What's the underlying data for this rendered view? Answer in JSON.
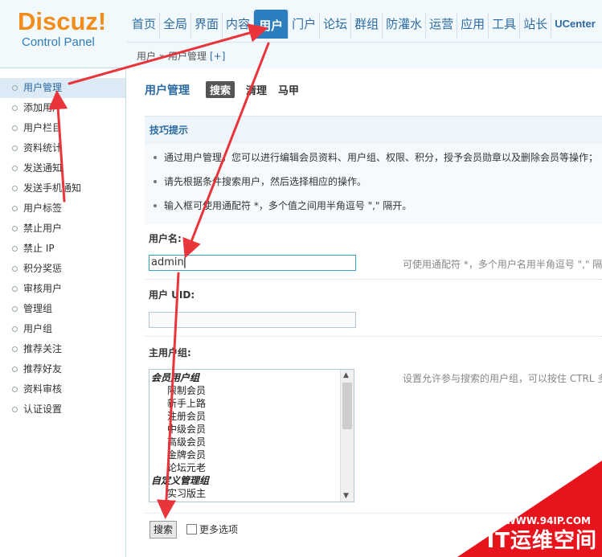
{
  "logo": {
    "brand": "Discuz!",
    "subtitle": "Control Panel"
  },
  "topnav": [
    "首页",
    "全局",
    "界面",
    "内容",
    "用户",
    "门户",
    "论坛",
    "群组",
    "防灌水",
    "运营",
    "应用",
    "工具",
    "站长",
    "UCenter"
  ],
  "topnav_active": "用户",
  "breadcrumb": {
    "path": "用户 » 用户管理",
    "add": "[+]"
  },
  "sidebar": {
    "items": [
      "用户管理",
      "添加用户",
      "用户栏目",
      "资料统计",
      "发送通知",
      "发送手机通知",
      "用户标签",
      "禁止用户",
      "禁止 IP",
      "积分奖惩",
      "审核用户",
      "管理组",
      "用户组",
      "推荐关注",
      "推荐好友",
      "资料审核",
      "认证设置"
    ],
    "active": "用户管理"
  },
  "page": {
    "title": "用户管理",
    "tabs": [
      "搜索",
      "清理",
      "马甲"
    ],
    "active_tab": "搜索"
  },
  "tips": {
    "heading": "技巧提示",
    "items": [
      "通过用户管理，您可以进行编辑会员资料、用户组、权限、积分，授予会员勋章以及删除会员等操作；",
      "请先根据条件搜索用户，然后选择相应的操作。",
      "输入框可使用通配符 *，多个值之间用半角逗号 \",\" 隔开。"
    ]
  },
  "form": {
    "username": {
      "label": "用户名:",
      "value": "admin",
      "hint": "可使用通配符 *，多个用户名用半角逗号 \",\" 隔开"
    },
    "uid": {
      "label": "用户 UID:",
      "value": ""
    },
    "group": {
      "label": "主用户组:",
      "hint": "设置允许参与搜索的用户组，可以按住 CTRL 多选",
      "optgroups": [
        {
          "label": "会员用户组",
          "options": [
            "限制会员",
            "新手上路",
            "注册会员",
            "中级会员",
            "高级会员",
            "金牌会员",
            "论坛元老"
          ]
        },
        {
          "label": "自定义管理组",
          "options": [
            "实习版主"
          ]
        }
      ]
    },
    "submit": "搜索",
    "more_options": "更多选项"
  },
  "watermark": {
    "url": "WWW.94IP.COM",
    "name": "IT运维空间"
  },
  "colors": {
    "accent": "#2b7fbe",
    "arrow": "#e8343a",
    "logo": "#f28c1b"
  }
}
